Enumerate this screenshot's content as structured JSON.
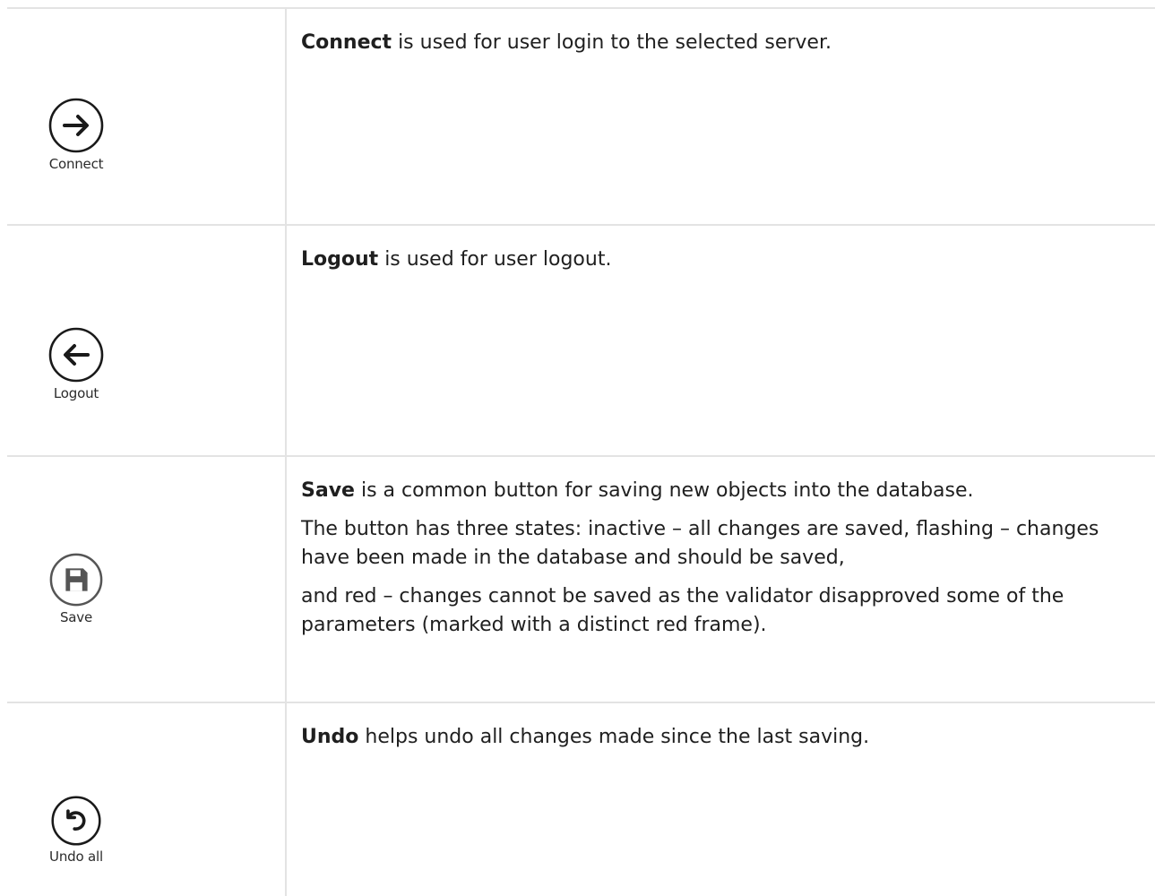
{
  "rows": [
    {
      "button": {
        "label": "Connect",
        "icon": "arrow-right-circle-icon"
      },
      "term": "Connect",
      "paragraphs": [
        "is used for user login to the selected server."
      ]
    },
    {
      "button": {
        "label": "Logout",
        "icon": "arrow-left-circle-icon"
      },
      "term": "Logout",
      "paragraphs": [
        "is used for user logout."
      ]
    },
    {
      "button": {
        "label": "Save",
        "icon": "floppy-disk-circle-icon"
      },
      "term": "Save",
      "paragraphs": [
        "is a common button for saving new objects into the database.",
        "The button has three states: inactive – all changes are saved, flashing – changes have been made in the database and should be saved,",
        "and red – changes cannot be saved as the validator disapproved some of the parameters (marked with a distinct red frame)."
      ]
    },
    {
      "button": {
        "label": "Undo all",
        "icon": "undo-circle-icon"
      },
      "term": "Undo",
      "paragraphs": [
        "helps undo all changes made since the last saving."
      ]
    }
  ],
  "colors": {
    "text": "#1f1f1f",
    "border": "#e3e3e3",
    "icon_stroke": "#1a1a1a"
  }
}
